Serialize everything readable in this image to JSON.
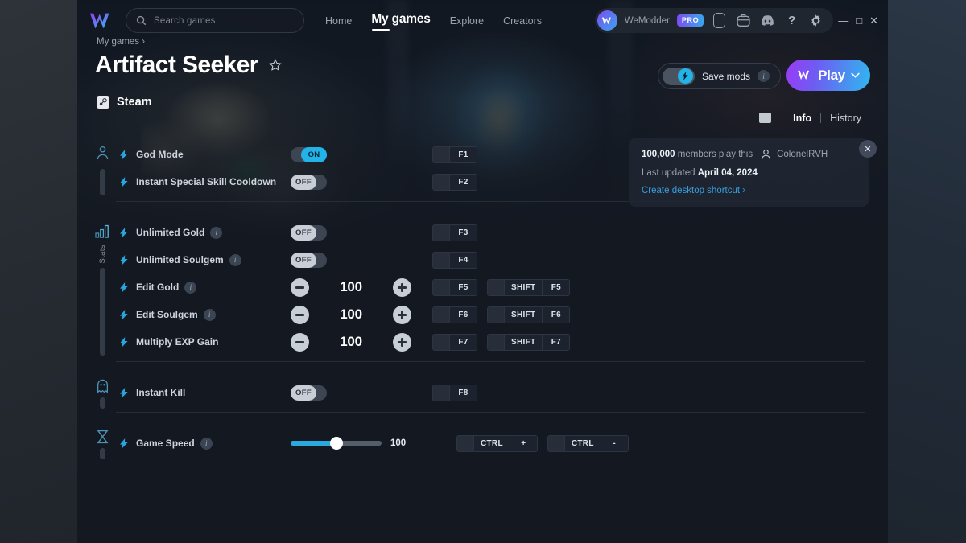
{
  "topbar": {
    "logo_icon": "wemodder-logo-icon",
    "search": {
      "icon": "search-icon",
      "placeholder": "Search games",
      "value": ""
    },
    "nav": [
      {
        "label": "Home",
        "active": false
      },
      {
        "label": "My games",
        "active": true
      },
      {
        "label": "Explore",
        "active": false
      },
      {
        "label": "Creators",
        "active": false
      }
    ],
    "account": {
      "avatar_icon": "wemodder-avatar-icon",
      "username": "WeModder",
      "badge": "PRO",
      "badge_gradient_from": "#7b4df0",
      "badge_gradient_to": "#3aa6ee"
    },
    "icons": [
      {
        "name": "phone-icon"
      },
      {
        "name": "briefcase-icon"
      },
      {
        "name": "discord-icon"
      },
      {
        "name": "help-icon",
        "glyph": "?"
      },
      {
        "name": "gear-icon"
      }
    ],
    "window_controls": [
      {
        "name": "minimize-button",
        "glyph": "—"
      },
      {
        "name": "maximize-button",
        "glyph": "□"
      },
      {
        "name": "close-button",
        "glyph": "✕"
      }
    ]
  },
  "header": {
    "breadcrumb": "My games ›",
    "title": "Artifact Seeker",
    "favorite_icon": "star-outline-icon",
    "platform": {
      "icon": "steam-icon",
      "label": "Steam"
    },
    "save_mods": {
      "label": "Save mods",
      "state": "on",
      "info_icon": "info-icon",
      "toggle_icon": "bolt-icon"
    },
    "play": {
      "label": "Play",
      "logo_icon": "wemodder-logo-icon",
      "chevron_icon": "chevron-down-icon"
    }
  },
  "tabs": {
    "panel_icon": "panel-icon",
    "items": [
      {
        "label": "Info",
        "active": true
      },
      {
        "label": "History",
        "active": false
      }
    ]
  },
  "info_card": {
    "members_count": "100,000",
    "members_text": "members play this",
    "author_icon": "user-icon",
    "author": "ColonelRVH",
    "last_updated_label": "Last updated",
    "last_updated_value": "April 04, 2024",
    "shortcut_link": "Create desktop shortcut ›",
    "link_color": "#3b9ddd",
    "close_icon": "close-icon"
  },
  "colors": {
    "accent_cyan": "#22b4e8",
    "toggle_off_pill": "#c9ced6",
    "app_bg": "#131821"
  },
  "groups": [
    {
      "rail_icon": "player-icon",
      "rail_label": "",
      "rows": [
        {
          "name": "God Mode",
          "bolt_icon": "bolt-icon",
          "has_info": false,
          "control": "toggle",
          "state": "ON",
          "hotkeys": [
            {
              "keys": [
                "F1"
              ]
            }
          ]
        },
        {
          "name": "Instant Special Skill Cooldown",
          "bolt_icon": "bolt-icon",
          "has_info": false,
          "control": "toggle",
          "state": "OFF",
          "hotkeys": [
            {
              "keys": [
                "F2"
              ]
            }
          ]
        }
      ]
    },
    {
      "rail_icon": "stats-icon",
      "rail_label": "Stats",
      "rows": [
        {
          "name": "Unlimited Gold",
          "bolt_icon": "bolt-icon",
          "has_info": true,
          "control": "toggle",
          "state": "OFF",
          "hotkeys": [
            {
              "keys": [
                "F3"
              ]
            }
          ]
        },
        {
          "name": "Unlimited Soulgem",
          "bolt_icon": "bolt-icon",
          "has_info": true,
          "control": "toggle",
          "state": "OFF",
          "hotkeys": [
            {
              "keys": [
                "F4"
              ]
            }
          ]
        },
        {
          "name": "Edit Gold",
          "bolt_icon": "bolt-icon",
          "has_info": true,
          "control": "stepper",
          "value": "100",
          "hotkeys": [
            {
              "keys": [
                "F5"
              ]
            },
            {
              "keys": [
                "SHIFT",
                "F5"
              ]
            }
          ]
        },
        {
          "name": "Edit Soulgem",
          "bolt_icon": "bolt-icon",
          "has_info": true,
          "control": "stepper",
          "value": "100",
          "hotkeys": [
            {
              "keys": [
                "F6"
              ]
            },
            {
              "keys": [
                "SHIFT",
                "F6"
              ]
            }
          ]
        },
        {
          "name": "Multiply EXP Gain",
          "bolt_icon": "bolt-icon",
          "has_info": false,
          "control": "stepper",
          "value": "100",
          "hotkeys": [
            {
              "keys": [
                "F7"
              ]
            },
            {
              "keys": [
                "SHIFT",
                "F7"
              ]
            }
          ]
        }
      ]
    },
    {
      "rail_icon": "ghost-icon",
      "rail_label": "",
      "rows": [
        {
          "name": "Instant Kill",
          "bolt_icon": "bolt-icon",
          "has_info": false,
          "control": "toggle",
          "state": "OFF",
          "hotkeys": [
            {
              "keys": [
                "F8"
              ]
            }
          ]
        }
      ]
    },
    {
      "rail_icon": "hourglass-icon",
      "rail_label": "",
      "rows": [
        {
          "name": "Game Speed",
          "bolt_icon": "bolt-icon",
          "has_info": true,
          "control": "slider",
          "value": "100",
          "slider_percent": 50,
          "hotkeys": [
            {
              "keys": [
                "CTRL",
                "+"
              ]
            },
            {
              "keys": [
                "CTRL",
                "-"
              ]
            }
          ]
        }
      ]
    }
  ]
}
